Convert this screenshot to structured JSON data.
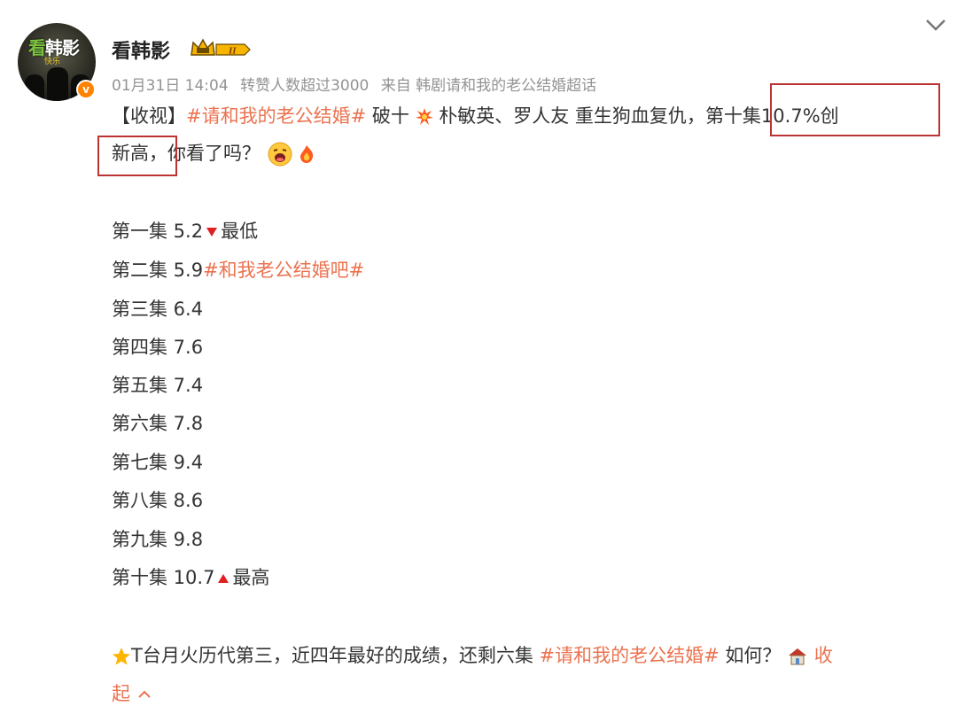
{
  "post": {
    "username": "看韩影",
    "vip_level": "II",
    "date": "01月31日 14:04",
    "repost_note": "转赞人数超过3000",
    "source": "来自 韩剧请和我的老公结婚超话",
    "headline_prefix": "【收视】",
    "headline_tag": "#请和我的老公结婚#",
    "headline_a": " 破十",
    "headline_b": " 朴敏英、罗人友 重生狗血复仇，",
    "headline_highlight_a": "第十集10.7%创",
    "headline_highlight_b": "新高，",
    "headline_c": "你看了吗？",
    "episodes": [
      {
        "label": "第一集 5.2",
        "suffix": "最低",
        "marker": "down"
      },
      {
        "label": "第二集 5.9",
        "tag": "#和我老公结婚吧#"
      },
      {
        "label": "第三集 6.4"
      },
      {
        "label": "第四集 7.6"
      },
      {
        "label": "第五集 7.4"
      },
      {
        "label": "第六集 7.8"
      },
      {
        "label": "第七集 9.4"
      },
      {
        "label": "第八集 8.6"
      },
      {
        "label": "第九集 9.8"
      },
      {
        "label": "第十集 10.7",
        "suffix": "最高",
        "marker": "up"
      }
    ],
    "footer_a": "T台月火历代第三，近四年最好的成绩，还剩六集 ",
    "footer_tag": "#请和我的老公结婚#",
    "footer_b": " 如何？",
    "collapse_a": "收",
    "collapse_b": "起"
  },
  "colors": {
    "accent": "#eb7350",
    "meta": "#939393",
    "box": "#b33333"
  },
  "icons": [
    "chevron-down-icon",
    "vip-crown-icon",
    "verified-icon",
    "explosion-emoji",
    "shocked-face-emoji",
    "fire-emoji",
    "star-emoji",
    "house-emoji",
    "chevron-up-icon"
  ]
}
